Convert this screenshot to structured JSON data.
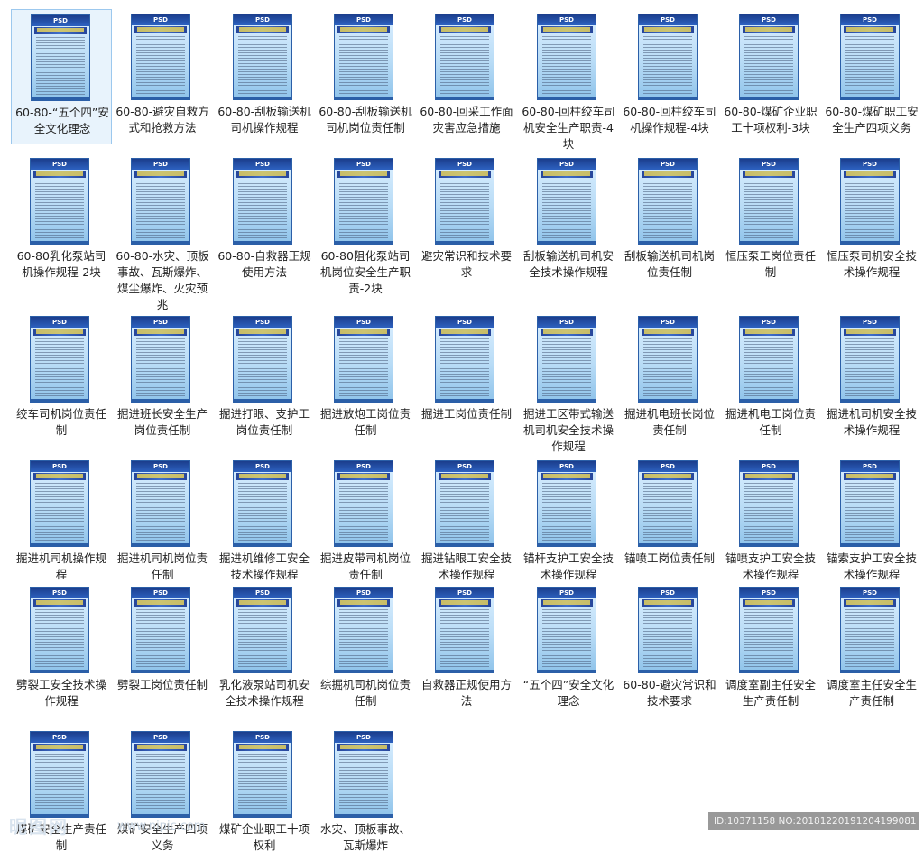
{
  "thumb_badge": "PSD",
  "items": [
    "60-80-“五个四”安全文化理念",
    "60-80-避灾自救方式和抢救方法",
    "60-80-刮板输送机司机操作规程",
    "60-80-刮板输送机司机岗位责任制",
    "60-80-回采工作面灾害应急措施",
    "60-80-回柱绞车司机安全生产职责-4块",
    "60-80-回柱绞车司机操作规程-4块",
    "60-80-煤矿企业职工十项权利-3块",
    "60-80-煤矿职工安全生产四项义务",
    "60-80乳化泵站司机操作规程-2块",
    "60-80-水灾、顶板事故、瓦斯爆炸、煤尘爆炸、火灾预兆",
    "60-80-自救器正规使用方法",
    "60-80阻化泵站司机岗位安全生产职责-2块",
    "避灾常识和技术要求",
    "刮板输送机司机安全技术操作规程",
    "刮板输送机司机岗位责任制",
    "恒压泵工岗位责任制",
    "恒压泵司机安全技术操作规程",
    "绞车司机岗位责任制",
    "掘进班长安全生产岗位责任制",
    "掘进打眼、支护工岗位责任制",
    "掘进放炮工岗位责任制",
    "掘进工岗位责任制",
    "掘进工区带式输送机司机安全技术操作规程",
    "掘进机电班长岗位责任制",
    "掘进机电工岗位责任制",
    "掘进机司机安全技术操作规程",
    "掘进机司机操作规程",
    "掘进机司机岗位责任制",
    "掘进机维修工安全技术操作规程",
    "掘进皮带司机岗位责任制",
    "掘进钻眼工安全技术操作规程",
    "锚杆支护工安全技术操作规程",
    "锚喷工岗位责任制",
    "锚喷支护工安全技术操作规程",
    "锚索支护工安全技术操作规程",
    "劈裂工安全技术操作规程",
    "劈裂工岗位责任制",
    "乳化液泵站司机安全技术操作规程",
    "综掘机司机岗位责任制",
    "自救器正规使用方法",
    "“五个四”安全文化理念",
    "60-80-避灾常识和技术要求",
    "调度室副主任安全生产责任制",
    "调度室主任安全生产责任制",
    "煤矿安全生产责任制",
    "煤矿安全生产四项义务",
    "煤矿企业职工十项权利",
    "水灾、顶板事故、瓦斯爆炸"
  ],
  "watermark": {
    "logo": "昵图网",
    "url": "www.nipic.com",
    "id_text": "ID:10371158 NO:20181220191204199081"
  },
  "colors": {
    "selected_bg": "#e8f3fc",
    "poster_header": "#1b3e8c"
  }
}
